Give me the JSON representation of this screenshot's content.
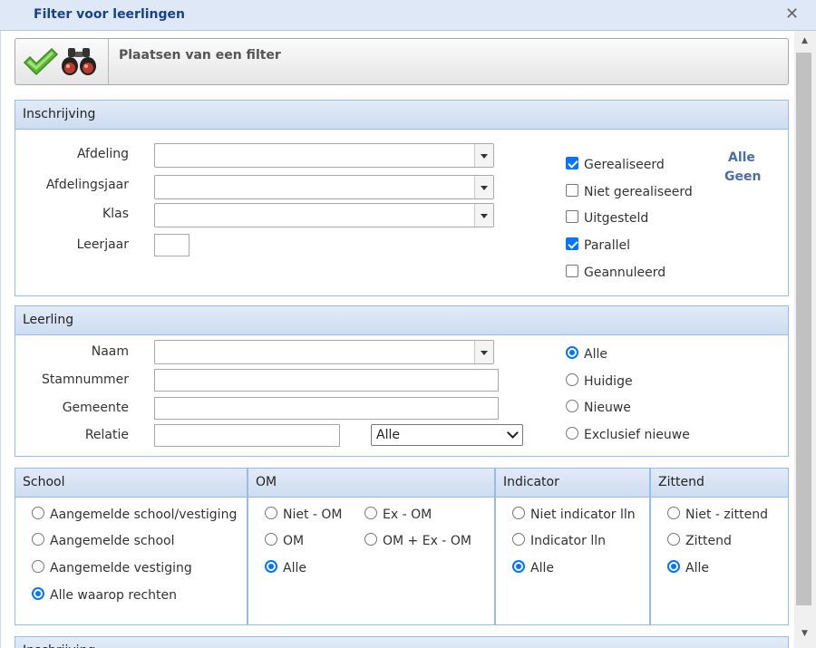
{
  "window": {
    "title": "Filter voor leerlingen"
  },
  "toolbar": {
    "label": "Plaatsen van een filter",
    "apply_icon": "check-icon",
    "search_icon": "binoculars-icon"
  },
  "inschrijving": {
    "header": "Inschrijving",
    "fields": {
      "afdeling": "Afdeling",
      "afdelingsjaar": "Afdelingsjaar",
      "klas": "Klas",
      "leerjaar": "Leerjaar"
    },
    "checks": [
      {
        "label": "Gerealiseerd",
        "checked": true
      },
      {
        "label": "Niet gerealiseerd",
        "checked": false
      },
      {
        "label": "Uitgesteld",
        "checked": false
      },
      {
        "label": "Parallel",
        "checked": true
      },
      {
        "label": "Geannuleerd",
        "checked": false
      }
    ],
    "all_link": "Alle",
    "none_link": "Geen"
  },
  "leerling": {
    "header": "Leerling",
    "fields": {
      "naam": "Naam",
      "stamnummer": "Stamnummer",
      "gemeente": "Gemeente",
      "relatie": "Relatie"
    },
    "relatie_select": "Alle",
    "radios": [
      {
        "label": "Alle",
        "checked": true
      },
      {
        "label": "Huidige",
        "checked": false
      },
      {
        "label": "Nieuwe",
        "checked": false
      },
      {
        "label": "Exclusief nieuwe",
        "checked": false
      }
    ]
  },
  "school": {
    "header": "School",
    "radios": [
      {
        "label": "Aangemelde school/vestiging",
        "checked": false
      },
      {
        "label": "Aangemelde school",
        "checked": false
      },
      {
        "label": "Aangemelde vestiging",
        "checked": false
      },
      {
        "label": "Alle waarop rechten",
        "checked": true
      }
    ]
  },
  "om": {
    "header": "OM",
    "radios": [
      {
        "label": "Niet - OM",
        "checked": false
      },
      {
        "label": "Ex - OM",
        "checked": false
      },
      {
        "label": "OM",
        "checked": false
      },
      {
        "label": "OM + Ex - OM",
        "checked": false
      },
      {
        "label": "Alle",
        "checked": true
      }
    ]
  },
  "indicator": {
    "header": "Indicator",
    "radios": [
      {
        "label": "Niet indicator lln",
        "checked": false
      },
      {
        "label": "Indicator lln",
        "checked": false
      },
      {
        "label": "Alle",
        "checked": true
      }
    ]
  },
  "zittend": {
    "header": "Zittend",
    "radios": [
      {
        "label": "Niet - zittend",
        "checked": false
      },
      {
        "label": "Zittend",
        "checked": false
      },
      {
        "label": "Alle",
        "checked": true
      }
    ]
  },
  "next_panel": {
    "header": "Inschrijving"
  }
}
